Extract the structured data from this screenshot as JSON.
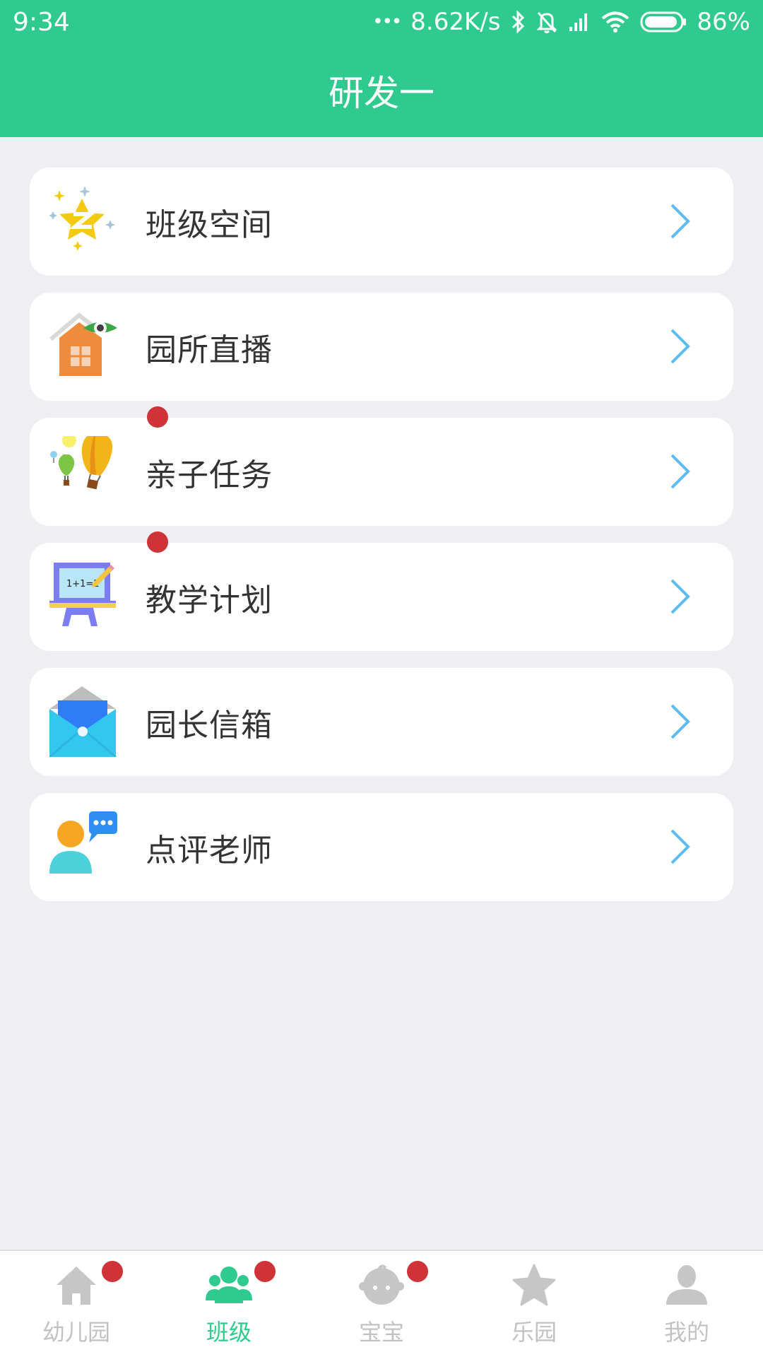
{
  "status_bar": {
    "time": "9:34",
    "dots": "•••",
    "network_speed": "8.62K/s",
    "battery_percent": "86%",
    "battery_level": 0.86,
    "icons": [
      "bluetooth-icon",
      "mute-bell-icon",
      "signal-icon",
      "wifi-icon",
      "battery-icon"
    ]
  },
  "header": {
    "title": "研发一"
  },
  "menu": {
    "items": [
      {
        "label": "班级空间",
        "icon": "star-z-icon",
        "badge": false
      },
      {
        "label": "园所直播",
        "icon": "house-eye-icon",
        "badge": false
      },
      {
        "label": "亲子任务",
        "icon": "balloon-icon",
        "badge": true
      },
      {
        "label": "教学计划",
        "icon": "blackboard-icon",
        "badge": true
      },
      {
        "label": "园长信箱",
        "icon": "mail-icon",
        "badge": false
      },
      {
        "label": "点评老师",
        "icon": "person-chat-icon",
        "badge": false
      }
    ]
  },
  "blackboard_text": "1+1=2",
  "tab_bar": {
    "tabs": [
      {
        "label": "幼儿园",
        "icon": "home-icon",
        "badge": true,
        "active": false
      },
      {
        "label": "班级",
        "icon": "group-icon",
        "badge": true,
        "active": true
      },
      {
        "label": "宝宝",
        "icon": "baby-icon",
        "badge": true,
        "active": false
      },
      {
        "label": "乐园",
        "icon": "star-icon",
        "badge": false,
        "active": false
      },
      {
        "label": "我的",
        "icon": "user-icon",
        "badge": false,
        "active": false
      }
    ]
  },
  "colors": {
    "brand": "#2fca8f",
    "badge": "#cf3237",
    "chevron": "#5bbcf0",
    "tab_inactive": "#c2c2c2",
    "background": "#efeff3"
  }
}
